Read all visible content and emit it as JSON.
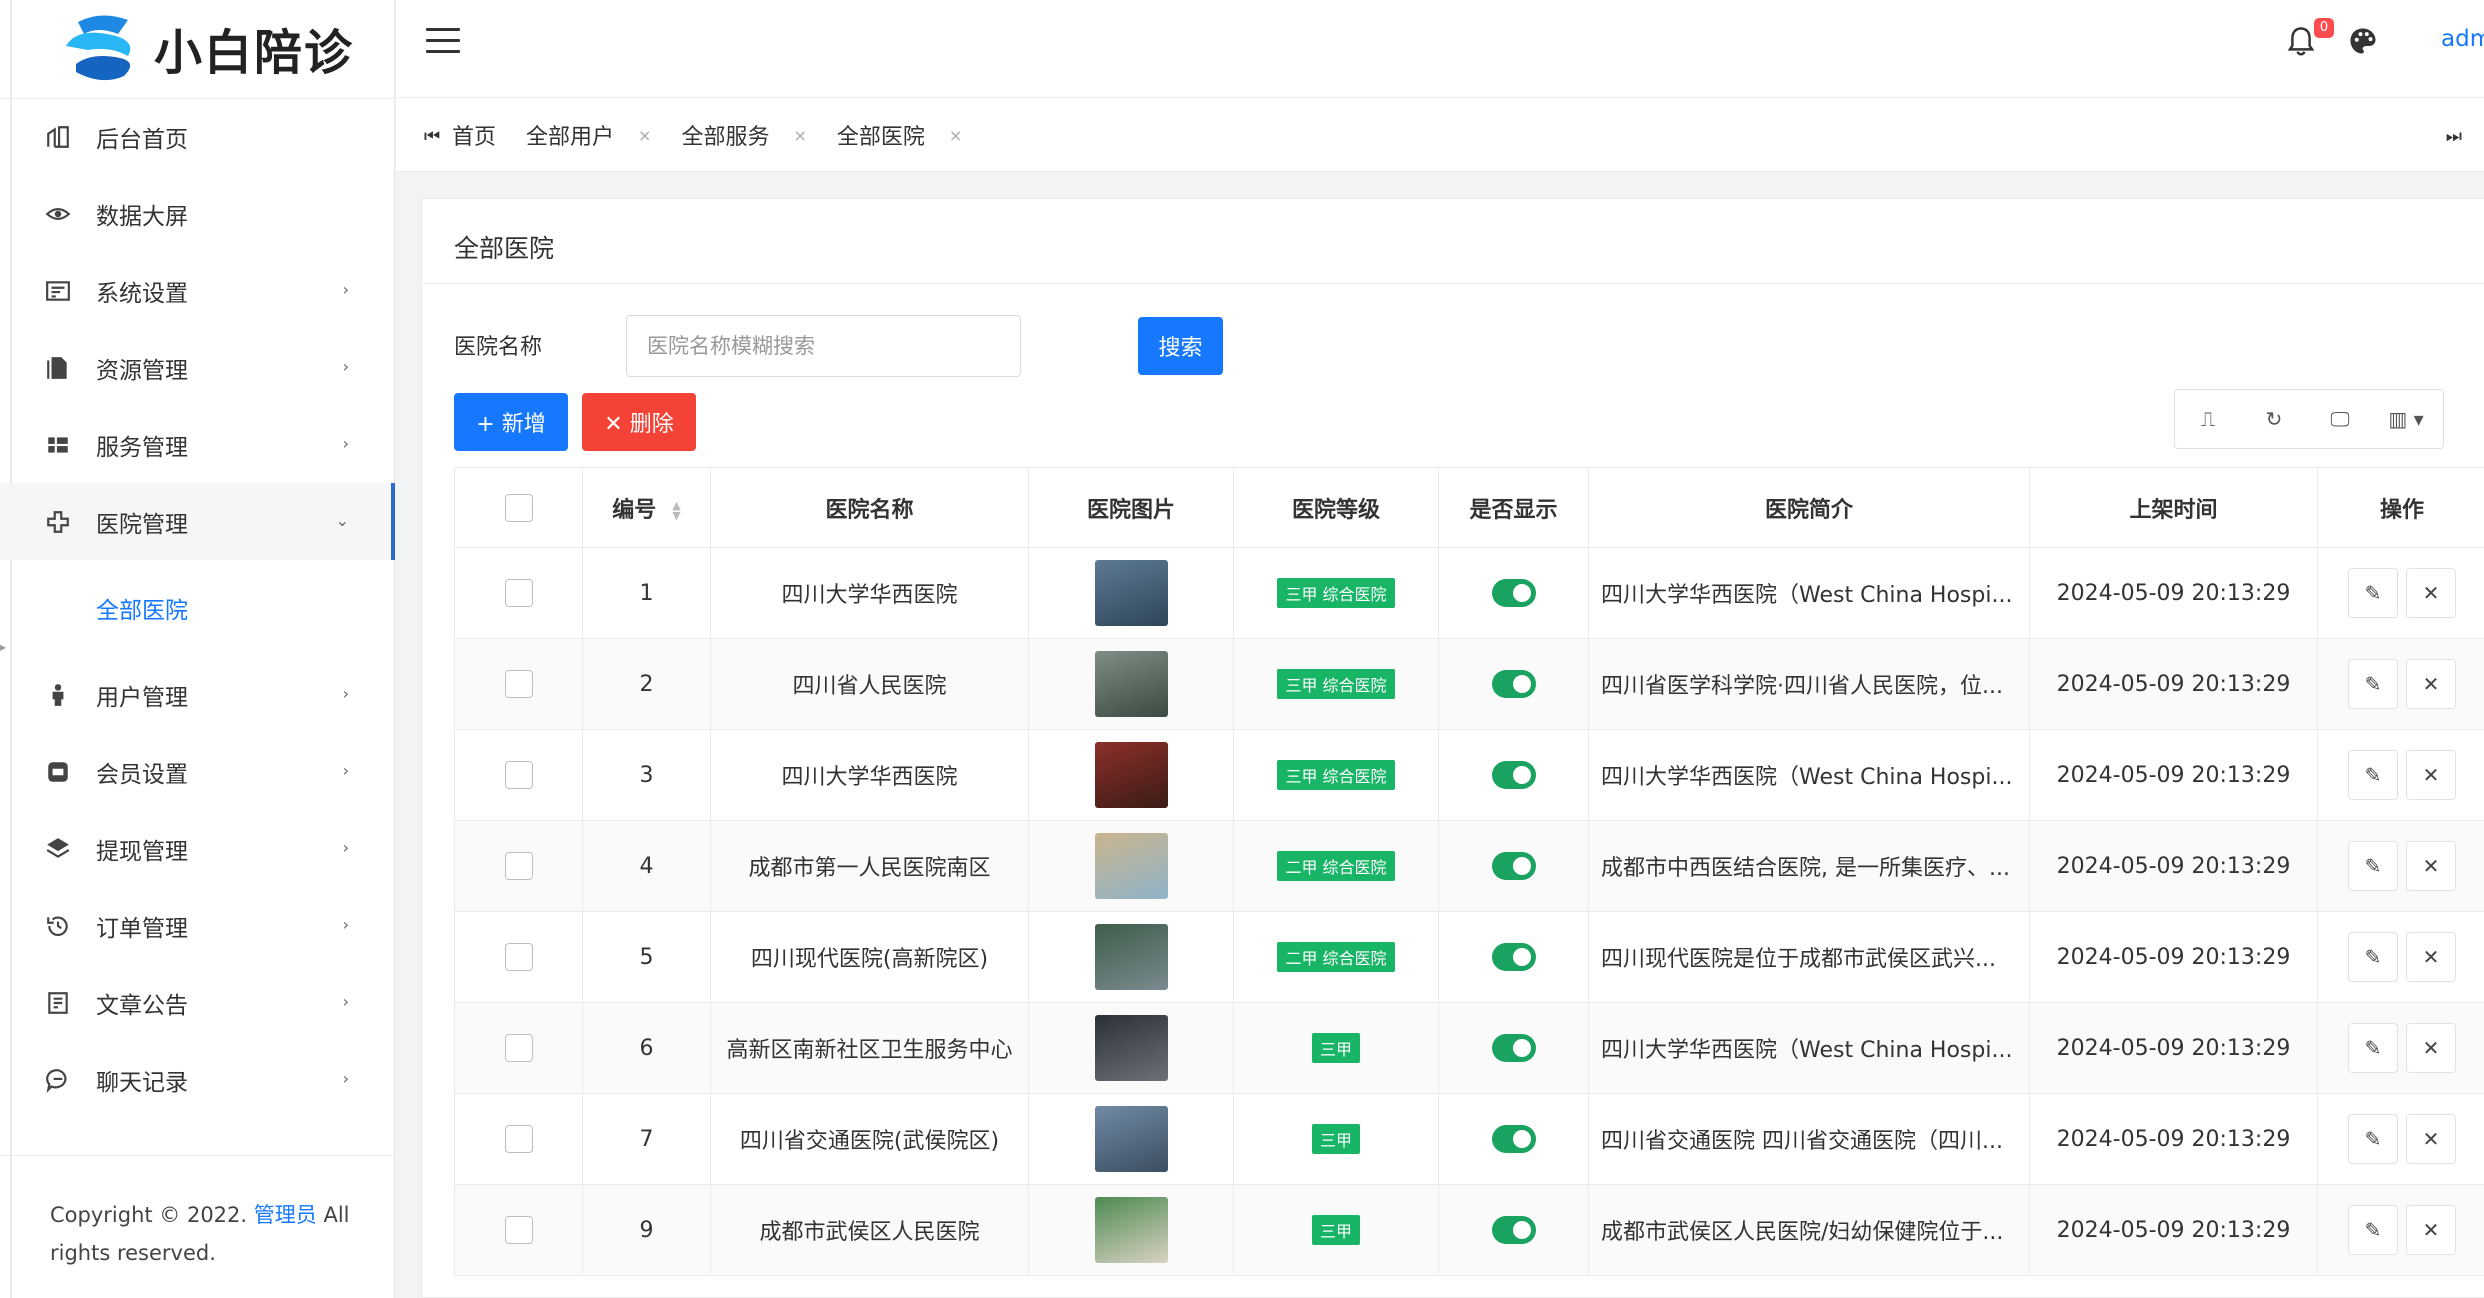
{
  "app": {
    "logo_text": "小白陪诊"
  },
  "sidebar": {
    "items": [
      {
        "label": "后台首页",
        "icon": "dashboard-icon",
        "has_children": false
      },
      {
        "label": "数据大屏",
        "icon": "eye-icon",
        "has_children": false
      },
      {
        "label": "系统设置",
        "icon": "settings-card-icon",
        "has_children": true
      },
      {
        "label": "资源管理",
        "icon": "file-icon",
        "has_children": true
      },
      {
        "label": "服务管理",
        "icon": "grid-icon",
        "has_children": true
      },
      {
        "label": "医院管理",
        "icon": "medical-cross-icon",
        "has_children": true,
        "expanded": true
      },
      {
        "label": "用户管理",
        "icon": "user-icon",
        "has_children": true
      },
      {
        "label": "会员设置",
        "icon": "member-card-icon",
        "has_children": true
      },
      {
        "label": "提现管理",
        "icon": "layers-icon",
        "has_children": true
      },
      {
        "label": "订单管理",
        "icon": "history-icon",
        "has_children": true
      },
      {
        "label": "文章公告",
        "icon": "article-icon",
        "has_children": true
      },
      {
        "label": "聊天记录",
        "icon": "chat-icon",
        "has_children": true
      }
    ],
    "sub_item": "全部医院",
    "copyright_prefix": "Copyright © 2022.",
    "copyright_link": "管理员",
    "copyright_suffix": "All rights reserved."
  },
  "header": {
    "notification_count": "0",
    "user": "adm"
  },
  "tabs": [
    "首页",
    "全部用户",
    "全部服务",
    "全部医院"
  ],
  "page": {
    "title": "全部医院",
    "search_label": "医院名称",
    "search_placeholder": "医院名称模糊搜索",
    "search_value": "",
    "search_button": "搜索",
    "add_button": "+ 新增",
    "delete_button": "✕ 删除"
  },
  "table": {
    "headers": [
      "",
      "编号",
      "医院名称",
      "医院图片",
      "医院等级",
      "是否显示",
      "医院简介",
      "上架时间",
      "操作"
    ],
    "rows": [
      {
        "id": "1",
        "name": "四川大学华西医院",
        "level": "三甲 综合医院",
        "shown": true,
        "intro": "四川大学华西医院（West China Hospi...",
        "time": "2024-05-09 20:13:29",
        "thumb": [
          "#5d7a93",
          "#2f4558"
        ]
      },
      {
        "id": "2",
        "name": "四川省人民医院",
        "level": "三甲 综合医院",
        "shown": true,
        "intro": "四川省医学科学院·四川省人民医院，位...",
        "time": "2024-05-09 20:13:29",
        "thumb": [
          "#7f8f86",
          "#3a4a40"
        ]
      },
      {
        "id": "3",
        "name": "四川大学华西医院",
        "level": "三甲 综合医院",
        "shown": true,
        "intro": "四川大学华西医院（West China Hospi...",
        "time": "2024-05-09 20:13:29",
        "thumb": [
          "#8c2f2a",
          "#3b1b16"
        ]
      },
      {
        "id": "4",
        "name": "成都市第一人民医院南区",
        "level": "二甲 综合医院",
        "shown": true,
        "intro": "成都市中西医结合医院, 是一所集医疗、...",
        "time": "2024-05-09 20:13:29",
        "thumb": [
          "#c9b48e",
          "#8fb3c9"
        ]
      },
      {
        "id": "5",
        "name": "四川现代医院(高新院区)",
        "level": "二甲 综合医院",
        "shown": true,
        "intro": "四川现代医院是位于成都市武侯区武兴...",
        "time": "2024-05-09 20:13:29",
        "thumb": [
          "#3f5d4a",
          "#7a8a8f"
        ]
      },
      {
        "id": "6",
        "name": "高新区南新社区卫生服务中心",
        "level": "三甲",
        "shown": true,
        "intro": "四川大学华西医院（West China Hospi...",
        "time": "2024-05-09 20:13:29",
        "thumb": [
          "#2b3138",
          "#6c7178"
        ]
      },
      {
        "id": "7",
        "name": "四川省交通医院(武侯院区)",
        "level": "三甲",
        "shown": true,
        "intro": "四川省交通医院 四川省交通医院（四川...",
        "time": "2024-05-09 20:13:29",
        "thumb": [
          "#6f8aa3",
          "#3c4e61"
        ]
      },
      {
        "id": "9",
        "name": "成都市武侯区人民医院",
        "level": "三甲",
        "shown": true,
        "intro": "成都市武侯区人民医院/妇幼保健院位于...",
        "time": "2024-05-09 20:13:29",
        "thumb": [
          "#4e8a52",
          "#d8d2c2"
        ]
      }
    ]
  },
  "colors": {
    "primary": "#1677ff",
    "danger": "#f44336",
    "success": "#18b566"
  }
}
